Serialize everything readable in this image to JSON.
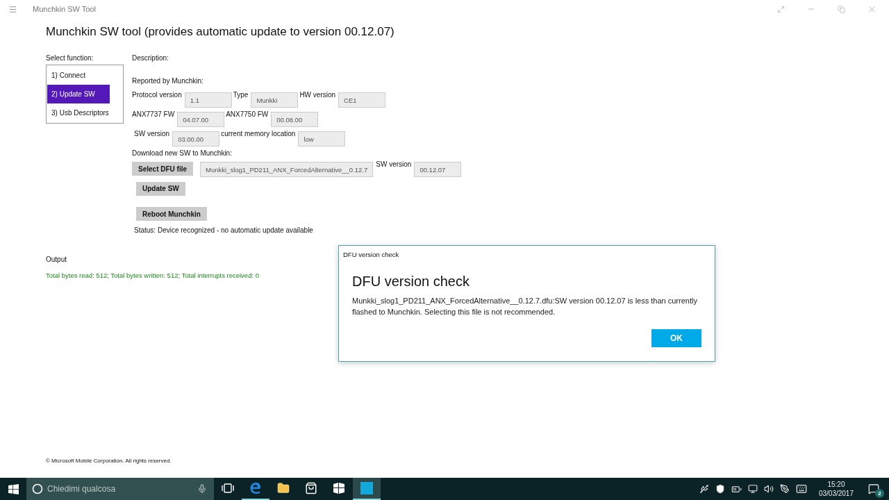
{
  "window": {
    "title": "Munchkin SW Tool"
  },
  "heading": "Munchkin SW tool (provides automatic update to version 00.12.07)",
  "function_list": {
    "label": "Select function:",
    "items": [
      {
        "label": "1) Connect",
        "selected": false
      },
      {
        "label": "2) Update SW",
        "selected": true
      },
      {
        "label": "3) Usb Descriptors",
        "selected": false
      }
    ]
  },
  "description_label": "Description:",
  "reported_label": "Reported by Munchkin:",
  "info_rows": [
    [
      {
        "label": "Protocol version",
        "value": "1.1"
      },
      {
        "label": "Type",
        "value": "Munkki"
      },
      {
        "label": "HW version",
        "value": "CE1"
      }
    ],
    [
      {
        "label": "ANX7737 FW",
        "value": "04.07.00"
      },
      {
        "label": "ANX7750 FW",
        "value": "00.08.00"
      }
    ],
    [
      {
        "label": "SW version",
        "value": "03.00.00"
      },
      {
        "label": "current memory location",
        "value": "low"
      }
    ]
  ],
  "download": {
    "label": "Download new SW to Munchkin:",
    "select_button": "Select DFU file",
    "file": "Munkki_slog1_PD211_ANX_ForcedAlternative__0.12.7",
    "sw_label": "SW version",
    "sw_value": "00.12.07"
  },
  "buttons": [
    "Update SW",
    "Reboot Munchkin"
  ],
  "status": "Status: Device recognized - no automatic update available",
  "output": {
    "label": "Output",
    "text": "Total bytes read: 512; Total bytes written: 512; Total interrupts received: 0"
  },
  "footer": "© Microsoft Mobile Corporation. All rights reserved.",
  "dialog": {
    "caption": "DFU version check",
    "title": "DFU version check",
    "message": "Munkki_slog1_PD211_ANX_ForcedAlternative__0.12.7.dfu:SW version 00.12.07 is less than currently flashed to Munchkin. Selecting this file is not recommended.",
    "ok": "OK"
  },
  "taskbar": {
    "search_placeholder": "Chiedimi qualcosa",
    "apps": [
      {
        "kind": "taskview",
        "running": false,
        "selected": false
      },
      {
        "kind": "browser",
        "running": true,
        "selected": false
      },
      {
        "kind": "folder",
        "running": false,
        "selected": false
      },
      {
        "kind": "store",
        "running": false,
        "selected": false
      },
      {
        "kind": "tiles",
        "running": false,
        "selected": false
      },
      {
        "kind": "tool",
        "running": true,
        "selected": true
      }
    ],
    "time": "15:20",
    "date": "03/03/2017",
    "notifications": "2"
  }
}
